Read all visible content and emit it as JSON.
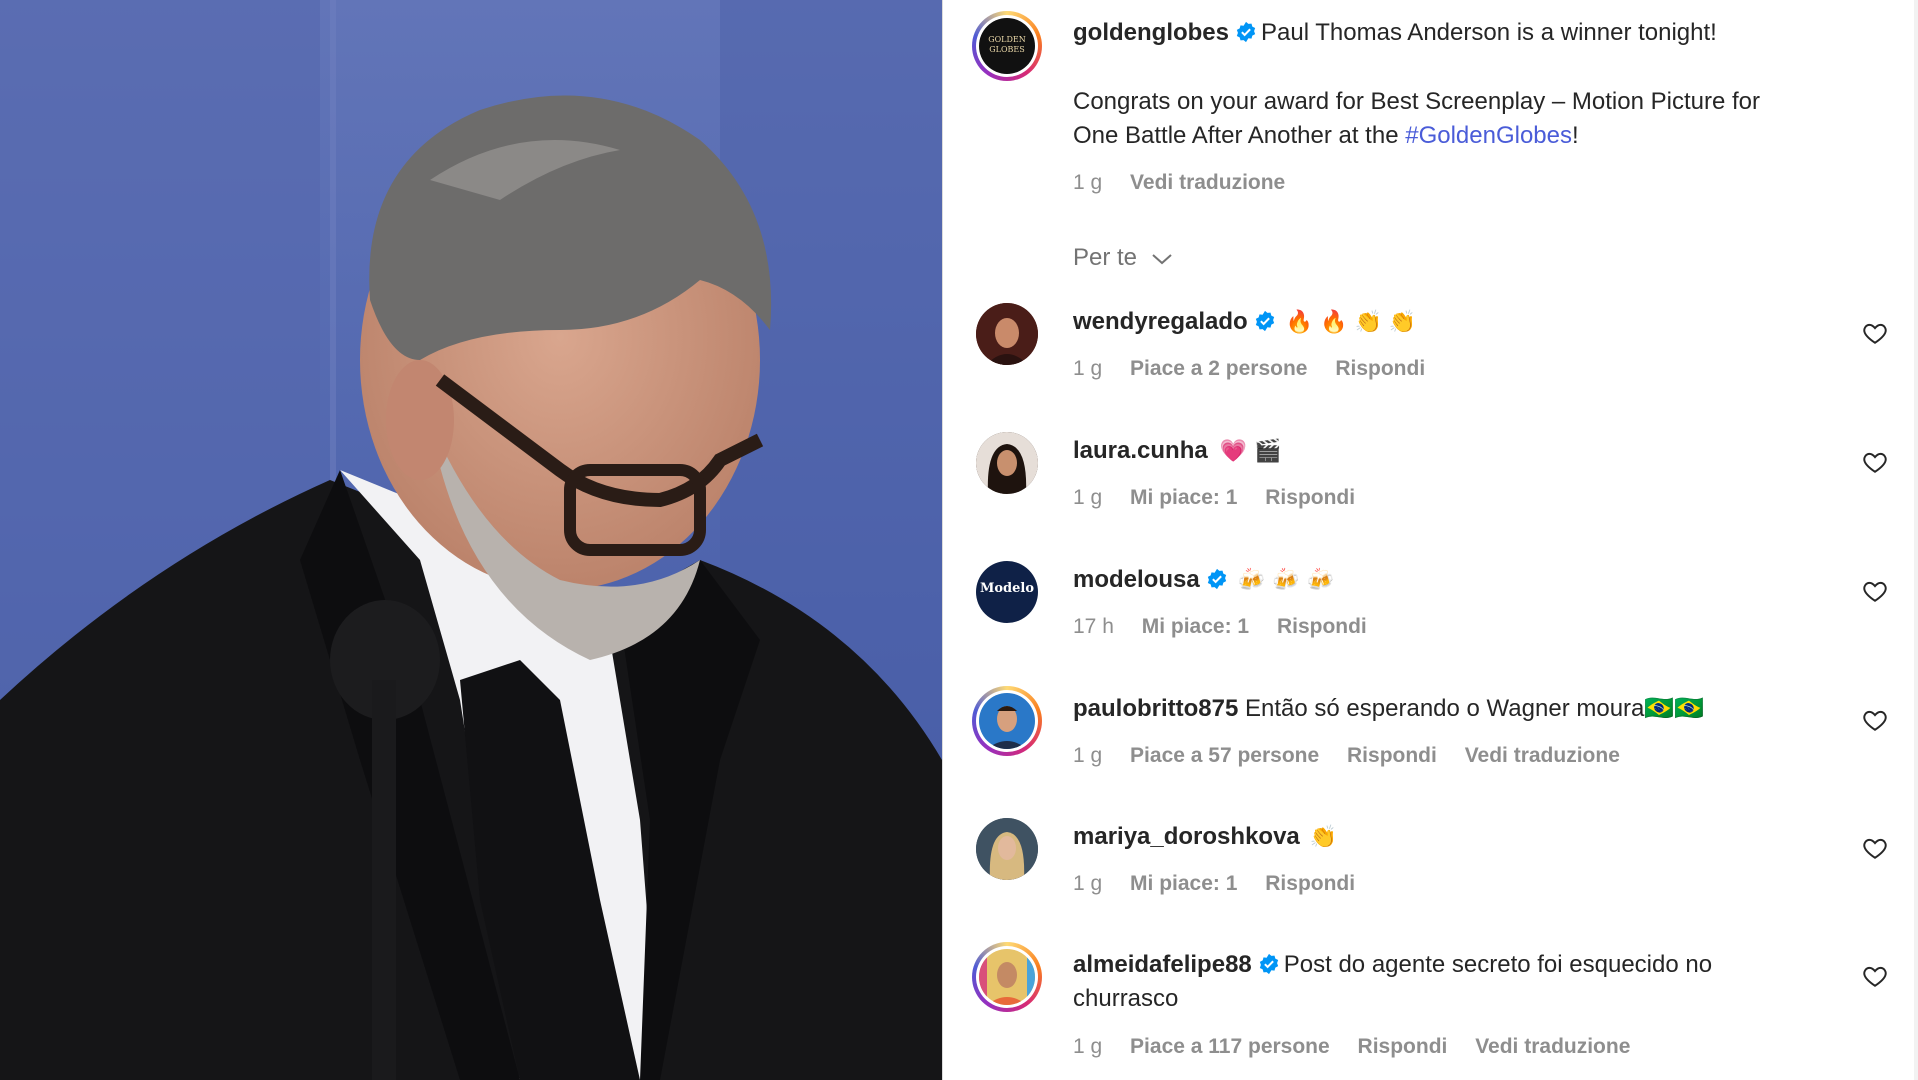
{
  "post": {
    "username": "goldenglobes",
    "logo_text": "GOLDEN GLOBES",
    "caption_line1": "Paul Thomas Anderson is a winner tonight!",
    "caption_line2a": "Congrats on your award for Best Screenplay – Motion Picture for",
    "caption_line2b": "One Battle After Another at the ",
    "hashtag": "#GoldenGlobes",
    "caption_end": "!",
    "time": "1 g",
    "translate": "Vedi traduzione"
  },
  "sort": {
    "label": "Per te"
  },
  "comments": [
    {
      "username": "wendyregalado",
      "verified": true,
      "text": "🔥 🔥 👏 👏",
      "time": "1 g",
      "likes": "Piace a 2 persone",
      "reply": "Rispondi",
      "translate": ""
    },
    {
      "username": "laura.cunha",
      "verified": false,
      "text": "💗 🎬",
      "time": "1 g",
      "likes": "Mi piace: 1",
      "reply": "Rispondi",
      "translate": ""
    },
    {
      "username": "modelousa",
      "verified": true,
      "avatar_text": "Modelo",
      "text": "🍻 🍻 🍻",
      "time": "17 h",
      "likes": "Mi piace: 1",
      "reply": "Rispondi",
      "translate": ""
    },
    {
      "username": "paulobritto875",
      "verified": false,
      "text": "Então só esperando o Wagner moura🇧🇷🇧🇷",
      "time": "1 g",
      "likes": "Piace a 57 persone",
      "reply": "Rispondi",
      "translate": "Vedi traduzione"
    },
    {
      "username": "mariya_doroshkova",
      "verified": false,
      "text": "👏",
      "time": "1 g",
      "likes": "Mi piace: 1",
      "reply": "Rispondi",
      "translate": ""
    },
    {
      "username": "almeidafelipe88",
      "verified": true,
      "text": "Post do agente secreto foi esquecido no",
      "text2": "churrasco",
      "time": "1 g",
      "likes": "Piace a 117 persone",
      "reply": "Rispondi",
      "translate": "Vedi traduzione"
    }
  ],
  "colors": {
    "verified": "#0095f6",
    "hashtag": "#4a5cd8",
    "meta": "#8e8e8e",
    "text": "#262626"
  }
}
